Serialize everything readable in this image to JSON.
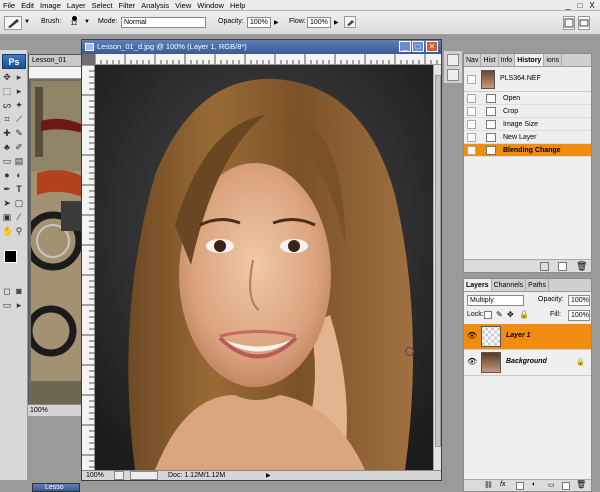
{
  "menubar": {
    "items": [
      "File",
      "Edit",
      "Image",
      "Layer",
      "Select",
      "Filter",
      "Analysis",
      "View",
      "Window",
      "Help"
    ]
  },
  "window_controls": {
    "minimize": "_",
    "maximize": "□",
    "close": "X"
  },
  "options": {
    "brush_label": "Brush:",
    "brush_size": "12",
    "mode_label": "Mode:",
    "mode_value": "Normal",
    "opacity_label": "Opacity:",
    "opacity_value": "100%",
    "flow_label": "Flow:",
    "flow_value": "100%"
  },
  "toolbox": {
    "logo": "Ps"
  },
  "background_doc": {
    "title": "Lesson_01",
    "zoom": "100%"
  },
  "document": {
    "title": "Lesson_01_d.jpg @ 100% (Layer 1, RGB/8*)",
    "zoom": "100%",
    "doc_size": "Doc: 1.12M/1.12M"
  },
  "history_panel": {
    "tabs": [
      "Nav",
      "Hist",
      "Info",
      "History",
      "ions"
    ],
    "snapshot_name": "PLS364.NEF",
    "items": [
      {
        "label": "Open",
        "selected": false
      },
      {
        "label": "Crop",
        "selected": false
      },
      {
        "label": "Image Size",
        "selected": false
      },
      {
        "label": "New Layer",
        "selected": false
      },
      {
        "label": "Blending Change",
        "selected": true
      }
    ]
  },
  "layers_panel": {
    "tabs": [
      "Layers",
      "Channels",
      "Paths"
    ],
    "blend_mode": "Multiply",
    "opacity_label": "Opacity:",
    "opacity_value": "100%",
    "lock_label": "Lock:",
    "fill_label": "Fill:",
    "fill_value": "100%",
    "layers": [
      {
        "name": "Layer 1",
        "selected": true
      },
      {
        "name": "Background",
        "selected": false
      }
    ]
  },
  "bottom_tab": "Lesso",
  "colors": {
    "selection": "#f08d10",
    "title_bar": "#4a6aa8"
  }
}
